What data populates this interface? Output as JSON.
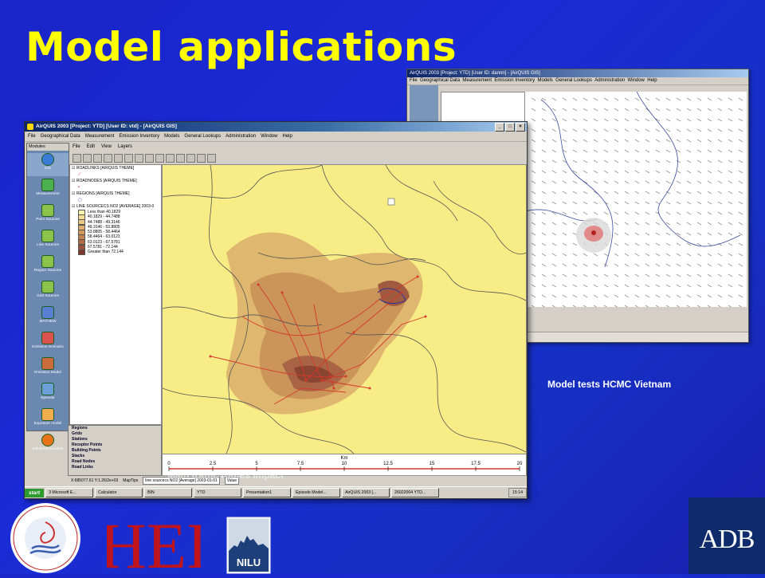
{
  "slide": {
    "title": "Model applications",
    "caption_right": "Model tests HCMC Vietnam",
    "overlay_text": "Main traffic routes impact"
  },
  "window_back": {
    "title": "AirQUIS 2003 [Project: YTD] [User ID: dannn] - [AirQUIS GIS]",
    "menu": [
      "File",
      "Geographical Data",
      "Measurement",
      "Emission Inventory",
      "Models",
      "General Lookups",
      "Administration",
      "Window",
      "Help"
    ]
  },
  "window_front": {
    "title": "AirQUIS 2003 [Project: YTD] [User ID: vtd] - [AirQUIS GIS]",
    "menu": [
      "File",
      "Geographical Data",
      "Measurement",
      "Emission Inventory",
      "Models",
      "General Lookups",
      "Administration",
      "Window",
      "Help"
    ],
    "inner_menu": [
      "File",
      "Edit",
      "View",
      "Layers"
    ],
    "modules_header": "Modules",
    "modules": [
      "GIS",
      "Measurement",
      "Point Sources",
      "Line Sources",
      "Region Sources",
      "Grid Sources",
      "MATHEW",
      "Emission Scenario",
      "Emission Model",
      "Episode",
      "Exposure model",
      "Industrial Accident"
    ],
    "themes": {
      "roadlinks": "ROADLINKS [AIRQUIS THEME]",
      "roadnodes": "ROADNODES [AIRQUIS THEME]",
      "regions": "REGIONS [AIRQUIS THEME]",
      "line_sources": "LINE SOURCECS NO2 [AVERAGE] 2003-0",
      "legend": [
        {
          "label": "Less than 40.1829",
          "color": "#fdf4b0"
        },
        {
          "label": "40.1829 - 44.7488",
          "color": "#f5dd96"
        },
        {
          "label": "44.7488 - 49.3146",
          "color": "#edc882"
        },
        {
          "label": "49.3146 - 53.8805",
          "color": "#deae6c"
        },
        {
          "label": "53.8805 - 58.4464",
          "color": "#d19a5c"
        },
        {
          "label": "58.4464 - 63.0123",
          "color": "#c2834f"
        },
        {
          "label": "63.0123 - 67.5781",
          "color": "#b06b44"
        },
        {
          "label": "67.5781 - 72.144",
          "color": "#9a5238"
        },
        {
          "label": "Greater than 72.144",
          "color": "#7e3a2c"
        }
      ]
    },
    "bottom_list": [
      "Regions",
      "Grids",
      "Stations",
      "Receptor Points",
      "Building Points",
      "Stacks",
      "Road Nodes",
      "Road Links"
    ],
    "scale": {
      "unit": "Km",
      "ticks": [
        "0",
        "2.5",
        "5",
        "7.5",
        "10",
        "12.5",
        "15",
        "17.5",
        "20"
      ]
    },
    "status": {
      "coords": "X:685077.61 Y:1.26/2e+03",
      "maptips_label": "MapTips",
      "maptips_value": "line sourcecs NO2 [Average] 2003-01-01",
      "value_label": "Value"
    },
    "taskbar": {
      "start": "start",
      "items": [
        "3 Microsoft E...",
        "Calculator",
        "BIN",
        "YTD",
        "Presentation1",
        "Episode Model...",
        "AirQUIS 2003 [...",
        "26022004 YTD..."
      ],
      "clock": "15:14"
    }
  },
  "logos": {
    "cai_text": "CLEAN AIR INITIATIVE for Asian Cities",
    "hei": "HEI",
    "nilu": "NILU",
    "adb": "ADB"
  },
  "colors": {
    "background": "#1a26c8",
    "title": "#ffff00",
    "map_base": "#f7ec86",
    "adb_blue": "#0f2b6b"
  }
}
